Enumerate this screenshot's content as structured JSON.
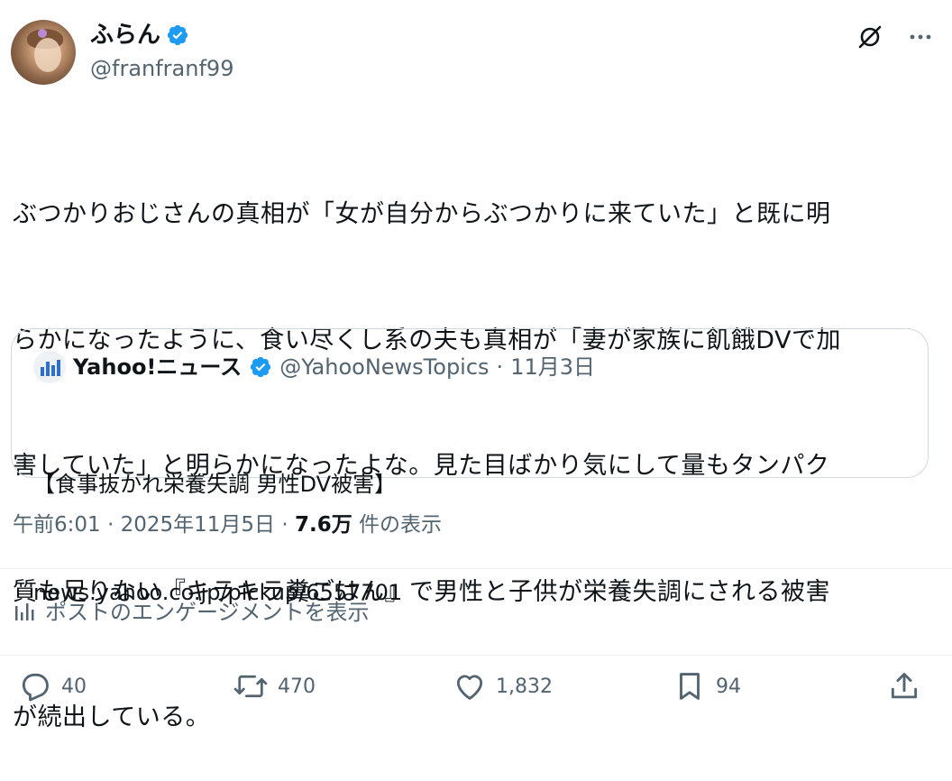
{
  "author": {
    "display_name": "ふらん",
    "handle": "@franfranf99",
    "verified": true,
    "verified_color": "#1d9bf0"
  },
  "top_icons": [
    "grok-icon",
    "more-icon"
  ],
  "tweet": {
    "lines": [
      "ぶつかりおじさんの真相が「女が自分からぶつかりに来ていた」と既に明",
      "らかになったように、食い尽くし系の夫も真相が「妻が家族に飢餓DVで加",
      "害していた」と明らかになったよな。見た目ばかり気にして量もタンパク",
      "質も足りない『キラキラ糞ごはん』で男性と子供が栄養失調にされる被害",
      "が続出している。"
    ]
  },
  "quote": {
    "name": "Yahoo!ニュース",
    "handle": "@YahooNewsTopics",
    "separator": "·",
    "date": "11月3日",
    "title": "【食事抜かれ栄養失調 男性DV被害】",
    "link": "news.yahoo.co.jp/pickup/6557701"
  },
  "meta": {
    "time": "午前6:01",
    "separator": "·",
    "date": "2025年11月5日",
    "views_count": "7.6万",
    "views_label": "件の表示"
  },
  "engagements_label": "ポストのエンゲージメントを表示",
  "actions": {
    "replies": "40",
    "reposts": "470",
    "likes": "1,832",
    "bookmarks": "94"
  },
  "colors": {
    "text": "#0f1419",
    "secondary": "#536471",
    "border": "#cfd9de",
    "divider": "#eff3f4"
  }
}
